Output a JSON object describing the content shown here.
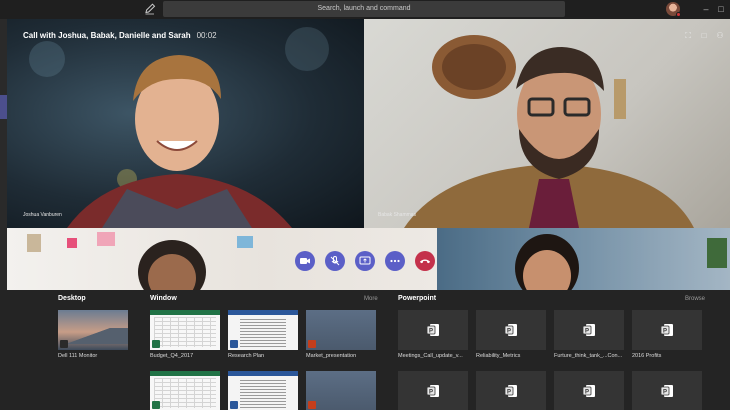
{
  "titlebar": {
    "search_placeholder": "Search, launch and command"
  },
  "call": {
    "title": "Call with Joshua, Babak, Danielle and Sarah",
    "duration": "00:02",
    "participants": [
      {
        "name": "Joshua Vanburen"
      },
      {
        "name": "Babak Shammas"
      },
      {
        "name": "Danielle"
      },
      {
        "name": "Sarah"
      }
    ]
  },
  "tray": {
    "desktop": {
      "title": "Desktop",
      "items": [
        {
          "label": "Dell 111 Monitor"
        }
      ]
    },
    "window": {
      "title": "Window",
      "more_label": "More",
      "items": [
        {
          "label": "Budget_Q4_2017",
          "app": "excel"
        },
        {
          "label": "Research Plan",
          "app": "word"
        },
        {
          "label": "Market_presentation",
          "app": "powerpoint"
        }
      ]
    },
    "powerpoint": {
      "title": "Powerpoint",
      "browse_label": "Browse",
      "items": [
        {
          "label": "Meetings_Call_update_v..."
        },
        {
          "label": "Reliability_Metrics"
        },
        {
          "label": "Furture_think_tank_...Con..."
        },
        {
          "label": "2016 Profits"
        }
      ]
    }
  },
  "colors": {
    "accent": "#5b5fc7",
    "hangup": "#c4314b",
    "tray_bg": "#242424",
    "titlebar_bg": "#1f1f1f"
  }
}
